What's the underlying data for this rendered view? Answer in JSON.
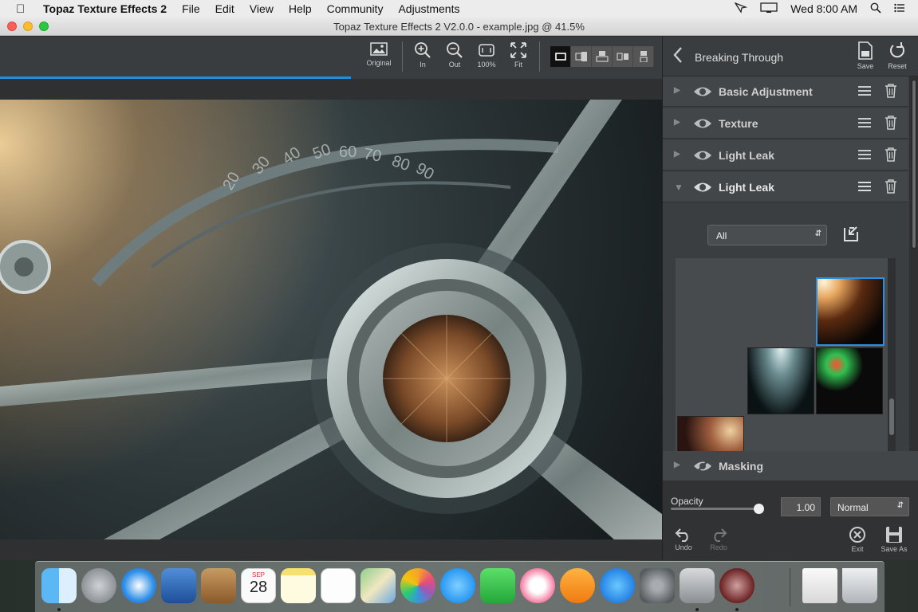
{
  "menubar": {
    "app_name": "Topaz Texture Effects 2",
    "items": [
      "File",
      "Edit",
      "View",
      "Help",
      "Community",
      "Adjustments"
    ],
    "clock": "Wed 8:00 AM"
  },
  "window": {
    "title": "Topaz Texture Effects 2 V2.0.0 - example.jpg @ 41.5%"
  },
  "toolbar": {
    "original_label": "Original",
    "zoom_in_label": "In",
    "zoom_out_label": "Out",
    "zoom_100_label": "100%",
    "fit_label": "Fit",
    "progress": 0.53
  },
  "panel": {
    "header_title": "Breaking Through",
    "save_label": "Save",
    "reset_label": "Reset",
    "layers": [
      {
        "name": "Basic Adjustment",
        "expanded": false
      },
      {
        "name": "Texture",
        "expanded": false
      },
      {
        "name": "Light Leak",
        "expanded": false
      },
      {
        "name": "Light Leak",
        "expanded": true
      }
    ],
    "filter_dropdown": "All",
    "masking_label": "Masking",
    "opacity_label": "Opacity",
    "opacity_value": "1.00",
    "blend_mode": "Normal",
    "undo_label": "Undo",
    "redo_label": "Redo",
    "exit_label": "Exit",
    "save_as_label": "Save As"
  },
  "dock": {
    "calendar_month": "SEP",
    "calendar_day": "28",
    "apps": [
      "finder-icon",
      "launchpad-icon",
      "safari-icon",
      "mail-icon",
      "contacts-icon",
      "calendar-icon",
      "notes-icon",
      "reminders-icon",
      "maps-icon",
      "photos-icon",
      "messages-icon",
      "facetime-icon",
      "itunes-icon",
      "ibooks-icon",
      "app-store-icon",
      "system-preferences-icon",
      "installer-icon",
      "topaz-icon",
      "file-icon",
      "trash-icon"
    ]
  }
}
